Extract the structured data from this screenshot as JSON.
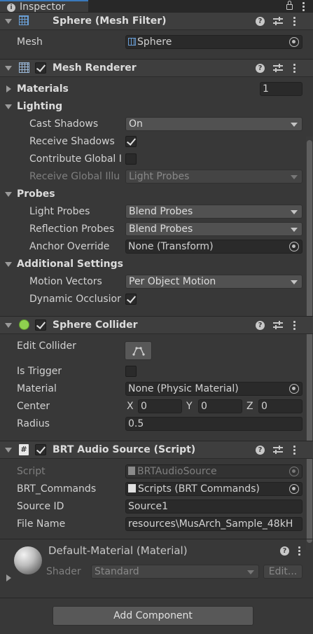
{
  "tab": {
    "title": "Inspector"
  },
  "mesh_filter": {
    "title": "Sphere (Mesh Filter)",
    "mesh_label": "Mesh",
    "mesh_value": "Sphere"
  },
  "mesh_renderer": {
    "title": "Mesh Renderer",
    "materials_label": "Materials",
    "materials_count": "1",
    "lighting_label": "Lighting",
    "cast_shadows_label": "Cast Shadows",
    "cast_shadows_value": "On",
    "receive_shadows_label": "Receive Shadows",
    "contribute_gi_label": "Contribute Global I",
    "receive_gi_label": "Receive Global Illu",
    "receive_gi_value": "Light Probes",
    "probes_label": "Probes",
    "light_probes_label": "Light Probes",
    "light_probes_value": "Blend Probes",
    "reflection_probes_label": "Reflection Probes",
    "reflection_probes_value": "Blend Probes",
    "anchor_override_label": "Anchor Override",
    "anchor_override_value": "None (Transform)",
    "additional_label": "Additional Settings",
    "motion_vectors_label": "Motion Vectors",
    "motion_vectors_value": "Per Object Motion",
    "dynamic_occlusion_label": "Dynamic Occlusior"
  },
  "sphere_collider": {
    "title": "Sphere Collider",
    "edit_collider_label": "Edit Collider",
    "is_trigger_label": "Is Trigger",
    "material_label": "Material",
    "material_value": "None (Physic Material)",
    "center_label": "Center",
    "x_label": "X",
    "x_value": "0",
    "y_label": "Y",
    "y_value": "0",
    "z_label": "Z",
    "z_value": "0",
    "radius_label": "Radius",
    "radius_value": "0.5"
  },
  "brt_audio": {
    "title": "BRT Audio Source (Script)",
    "script_label": "Script",
    "script_value": "BRTAudioSource",
    "commands_label": "BRT_Commands",
    "commands_value": "Scripts (BRT Commands)",
    "source_id_label": "Source ID",
    "source_id_value": "Source1",
    "file_name_label": "File Name",
    "file_name_value": "resources\\MusArch_Sample_48kH"
  },
  "material": {
    "title": "Default-Material (Material)",
    "shader_label": "Shader",
    "shader_value": "Standard",
    "edit_label": "Edit..."
  },
  "add_component_label": "Add Component",
  "colors": {
    "accent": "#3a79bb",
    "header": "#3e3e3e",
    "panel": "#383838",
    "field": "#2a2a2a",
    "script_icon": "#6ab04c",
    "collider_icon": "#8fd14f"
  }
}
